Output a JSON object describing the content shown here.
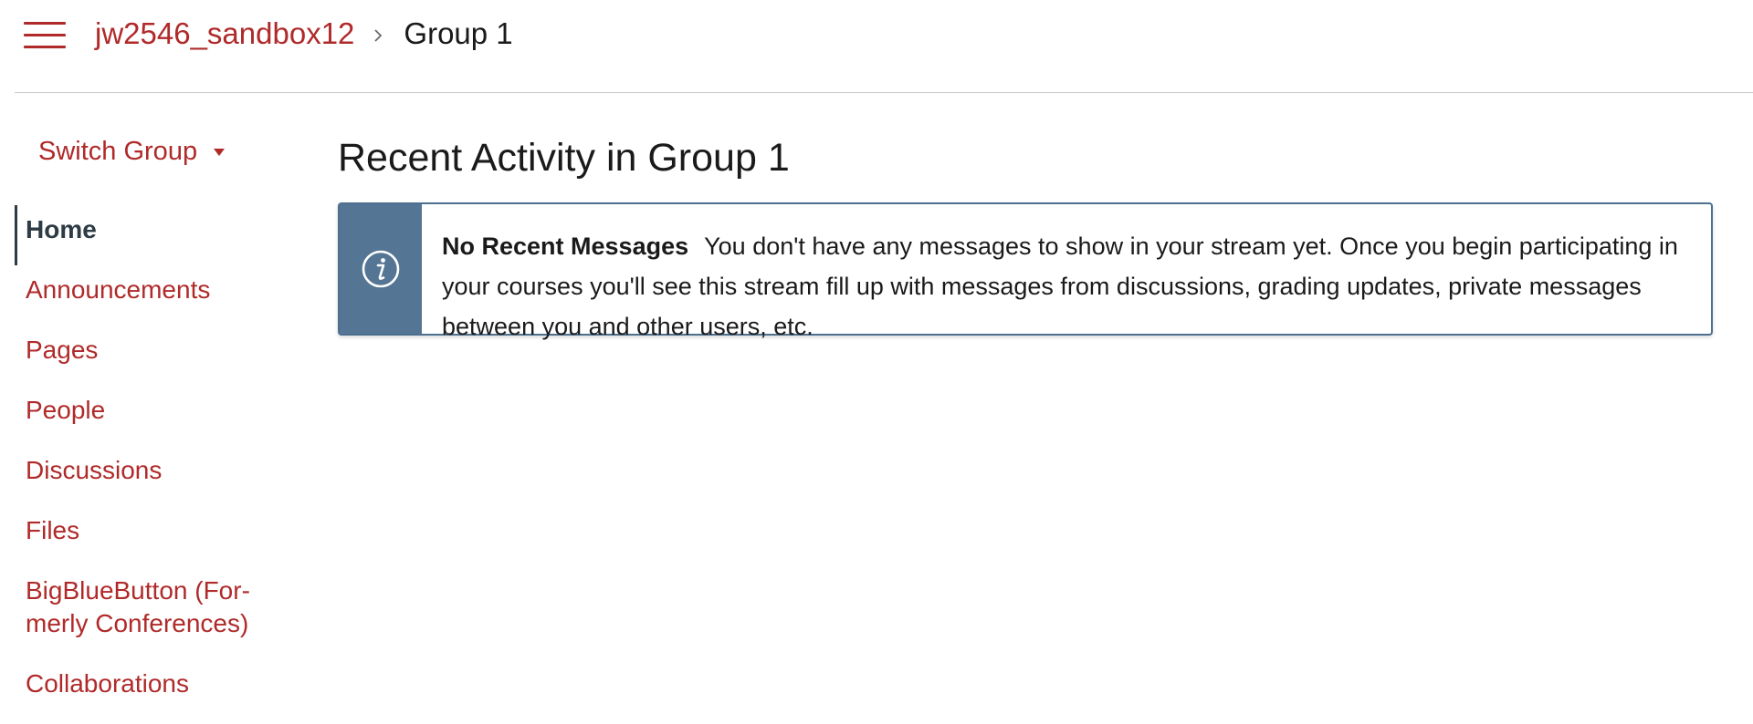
{
  "header": {
    "menu_icon": "hamburger-icon",
    "breadcrumb": {
      "course_link": "jw2546_sandbox12",
      "separator_icon": "chevron-right-icon",
      "current": "Group 1"
    }
  },
  "sidebar": {
    "switch_group_label": "Switch Group",
    "switch_group_icon": "caret-down-icon",
    "items": [
      {
        "label": "Home",
        "active": true
      },
      {
        "label": "Announcements",
        "active": false
      },
      {
        "label": "Pages",
        "active": false
      },
      {
        "label": "People",
        "active": false
      },
      {
        "label": "Discussions",
        "active": false
      },
      {
        "label": "Files",
        "active": false
      },
      {
        "label": "BigBlueButton (For-merly Conferences)",
        "line1": "BigBlueButton (For-",
        "line2": "merly Conferences)",
        "active": false
      },
      {
        "label": "Collaborations",
        "active": false
      }
    ]
  },
  "main": {
    "title": "Recent Activity in Group 1",
    "alert": {
      "icon": "info-icon",
      "heading": "No Recent Messages",
      "body": "You don't have any messages to show in your stream yet. Once you begin participating in your courses you'll see this stream fill up with messages from discussions, grading updates, private messages between you and other users, etc."
    }
  },
  "colors": {
    "link": "#b02a2a",
    "active_nav": "#2d3b45",
    "alert_accent": "#547694",
    "alert_border": "#4e7090",
    "divider": "#c8c8c8"
  }
}
